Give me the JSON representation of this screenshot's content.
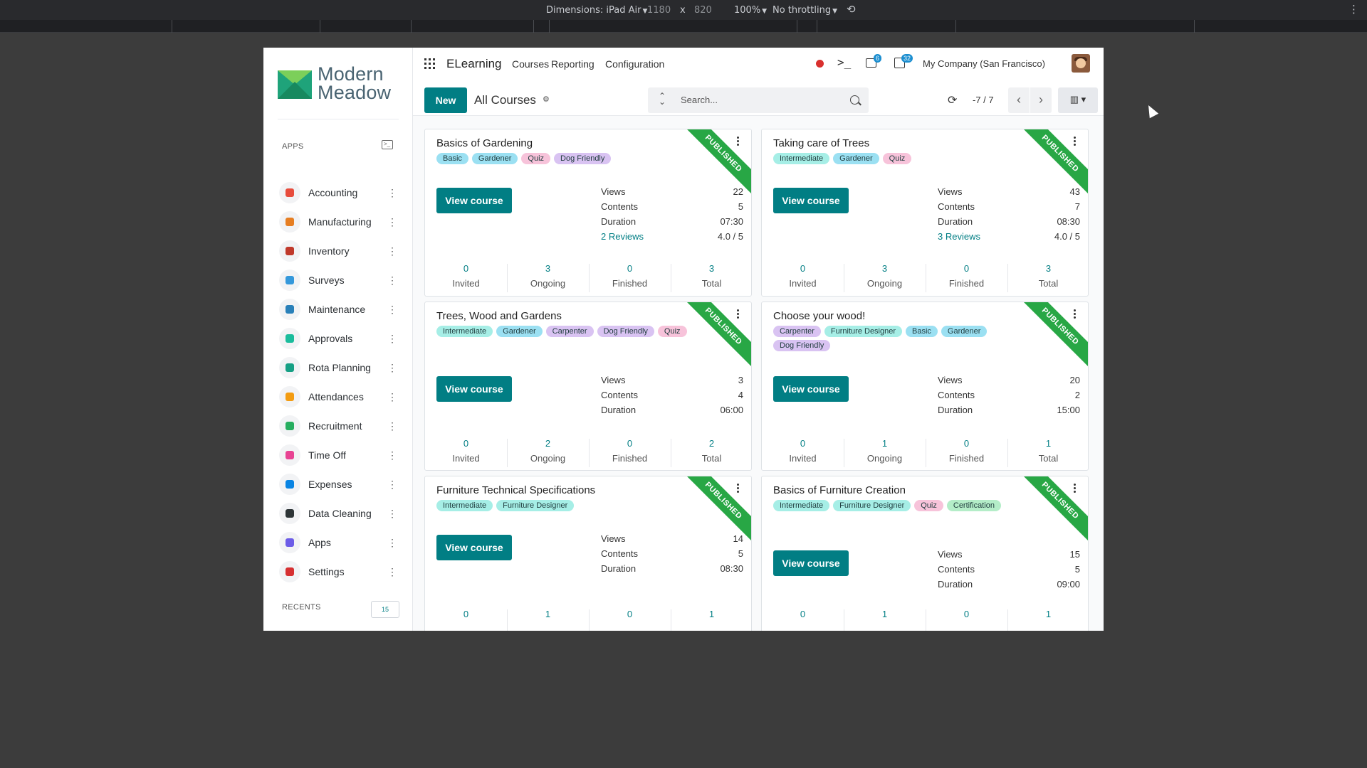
{
  "devtools": {
    "dimensions_label": "Dimensions: iPad Air",
    "width": "1180",
    "times": "x",
    "height": "820",
    "zoom": "100%",
    "throttling": "No throttling",
    "rotate_icon": "rotate-icon",
    "more_icon": "vertical-dots-icon"
  },
  "sidebar": {
    "logo_text_line1": "Modern",
    "logo_text_line2": "Meadow",
    "apps_header": "APPS",
    "items": [
      {
        "label": "Accounting",
        "color": "#e74c3c",
        "icon": "accounting-icon"
      },
      {
        "label": "Manufacturing",
        "color": "#e67e22",
        "icon": "manufacturing-icon"
      },
      {
        "label": "Inventory",
        "color": "#c0392b",
        "icon": "inventory-icon"
      },
      {
        "label": "Surveys",
        "color": "#3498db",
        "icon": "surveys-icon"
      },
      {
        "label": "Maintenance",
        "color": "#2980b9",
        "icon": "maintenance-icon"
      },
      {
        "label": "Approvals",
        "color": "#1abc9c",
        "icon": "approvals-icon"
      },
      {
        "label": "Rota Planning",
        "color": "#16a085",
        "icon": "rota-planning-icon"
      },
      {
        "label": "Attendances",
        "color": "#f39c12",
        "icon": "attendances-icon"
      },
      {
        "label": "Recruitment",
        "color": "#27ae60",
        "icon": "recruitment-icon"
      },
      {
        "label": "Time Off",
        "color": "#e84393",
        "icon": "time-off-icon"
      },
      {
        "label": "Expenses",
        "color": "#0984e3",
        "icon": "expenses-icon"
      },
      {
        "label": "Data Cleaning",
        "color": "#2d3436",
        "icon": "data-cleaning-icon"
      },
      {
        "label": "Apps",
        "color": "#6c5ce7",
        "icon": "apps-icon"
      },
      {
        "label": "Settings",
        "color": "#d63031",
        "icon": "settings-icon"
      }
    ],
    "recents_header": "RECENTS",
    "recents_count": "15"
  },
  "topnav": {
    "app_title": "ELearning",
    "menu": [
      "Courses",
      "Reporting",
      "Configuration"
    ],
    "messages_badge": "6",
    "activities_badge": "32",
    "company": "My Company (San Francisco)"
  },
  "control": {
    "new_label": "New",
    "breadcrumb": "All Courses",
    "search_placeholder": "Search...",
    "pager": "-7 / 7"
  },
  "colors": {
    "accent": "#017e84",
    "ribbon": "#28a745",
    "tag_teal": "#a6eee6",
    "tag_blue": "#9be0f2",
    "tag_pink": "#f7c3da",
    "tag_purple": "#d9c3f2",
    "tag_green": "#b4edc8"
  },
  "courses": [
    {
      "title": "Basics of Gardening",
      "ribbon": "PUBLISHED",
      "tags": [
        {
          "label": "Basic",
          "color": "#9be0f2"
        },
        {
          "label": "Gardener",
          "color": "#9be0f2"
        },
        {
          "label": "Quiz",
          "color": "#f7c3da"
        },
        {
          "label": "Dog Friendly",
          "color": "#d9c3f2"
        }
      ],
      "button": "View course",
      "stats": {
        "views_label": "Views",
        "views": "22",
        "contents_label": "Contents",
        "contents": "5",
        "duration_label": "Duration",
        "duration": "07:30",
        "reviews_label": "2 Reviews",
        "rating": "4.0 / 5"
      },
      "counters": [
        {
          "n": "0",
          "l": "Invited"
        },
        {
          "n": "3",
          "l": "Ongoing"
        },
        {
          "n": "0",
          "l": "Finished"
        },
        {
          "n": "3",
          "l": "Total"
        }
      ]
    },
    {
      "title": "Taking care of Trees",
      "ribbon": "PUBLISHED",
      "tags": [
        {
          "label": "Intermediate",
          "color": "#a6eee6"
        },
        {
          "label": "Gardener",
          "color": "#9be0f2"
        },
        {
          "label": "Quiz",
          "color": "#f7c3da"
        }
      ],
      "button": "View course",
      "stats": {
        "views_label": "Views",
        "views": "43",
        "contents_label": "Contents",
        "contents": "7",
        "duration_label": "Duration",
        "duration": "08:30",
        "reviews_label": "3 Reviews",
        "rating": "4.0 / 5"
      },
      "counters": [
        {
          "n": "0",
          "l": "Invited"
        },
        {
          "n": "3",
          "l": "Ongoing"
        },
        {
          "n": "0",
          "l": "Finished"
        },
        {
          "n": "3",
          "l": "Total"
        }
      ]
    },
    {
      "title": "Trees, Wood and Gardens",
      "ribbon": "PUBLISHED",
      "tags": [
        {
          "label": "Intermediate",
          "color": "#a6eee6"
        },
        {
          "label": "Gardener",
          "color": "#9be0f2"
        },
        {
          "label": "Carpenter",
          "color": "#d9c3f2"
        },
        {
          "label": "Dog Friendly",
          "color": "#d9c3f2"
        },
        {
          "label": "Quiz",
          "color": "#f7c3da"
        }
      ],
      "button": "View course",
      "stats": {
        "views_label": "Views",
        "views": "3",
        "contents_label": "Contents",
        "contents": "4",
        "duration_label": "Duration",
        "duration": "06:00"
      },
      "counters": [
        {
          "n": "0",
          "l": "Invited"
        },
        {
          "n": "2",
          "l": "Ongoing"
        },
        {
          "n": "0",
          "l": "Finished"
        },
        {
          "n": "2",
          "l": "Total"
        }
      ]
    },
    {
      "title": "Choose your wood!",
      "ribbon": "PUBLISHED",
      "tags": [
        {
          "label": "Carpenter",
          "color": "#d9c3f2"
        },
        {
          "label": "Furniture Designer",
          "color": "#a6eee6"
        },
        {
          "label": "Basic",
          "color": "#9be0f2"
        },
        {
          "label": "Gardener",
          "color": "#9be0f2"
        },
        {
          "label": "Dog Friendly",
          "color": "#d9c3f2"
        }
      ],
      "button": "View course",
      "stats": {
        "views_label": "Views",
        "views": "20",
        "contents_label": "Contents",
        "contents": "2",
        "duration_label": "Duration",
        "duration": "15:00"
      },
      "counters": [
        {
          "n": "0",
          "l": "Invited"
        },
        {
          "n": "1",
          "l": "Ongoing"
        },
        {
          "n": "0",
          "l": "Finished"
        },
        {
          "n": "1",
          "l": "Total"
        }
      ]
    },
    {
      "title": "Furniture Technical Specifications",
      "ribbon": "PUBLISHED",
      "tags": [
        {
          "label": "Intermediate",
          "color": "#a6eee6"
        },
        {
          "label": "Furniture Designer",
          "color": "#a6eee6"
        }
      ],
      "button": "View course",
      "stats": {
        "views_label": "Views",
        "views": "14",
        "contents_label": "Contents",
        "contents": "5",
        "duration_label": "Duration",
        "duration": "08:30"
      },
      "counters": [
        {
          "n": "0",
          "l": ""
        },
        {
          "n": "1",
          "l": ""
        },
        {
          "n": "0",
          "l": ""
        },
        {
          "n": "1",
          "l": ""
        }
      ]
    },
    {
      "title": "Basics of Furniture Creation",
      "ribbon": "PUBLISHED",
      "tags": [
        {
          "label": "Intermediate",
          "color": "#a6eee6"
        },
        {
          "label": "Furniture Designer",
          "color": "#a6eee6"
        },
        {
          "label": "Quiz",
          "color": "#f7c3da"
        },
        {
          "label": "Certification",
          "color": "#b4edc8"
        }
      ],
      "button": "View course",
      "stats": {
        "views_label": "Views",
        "views": "15",
        "contents_label": "Contents",
        "contents": "5",
        "duration_label": "Duration",
        "duration": "09:00"
      },
      "counters": [
        {
          "n": "0",
          "l": ""
        },
        {
          "n": "1",
          "l": ""
        },
        {
          "n": "0",
          "l": ""
        },
        {
          "n": "1",
          "l": ""
        }
      ]
    }
  ]
}
